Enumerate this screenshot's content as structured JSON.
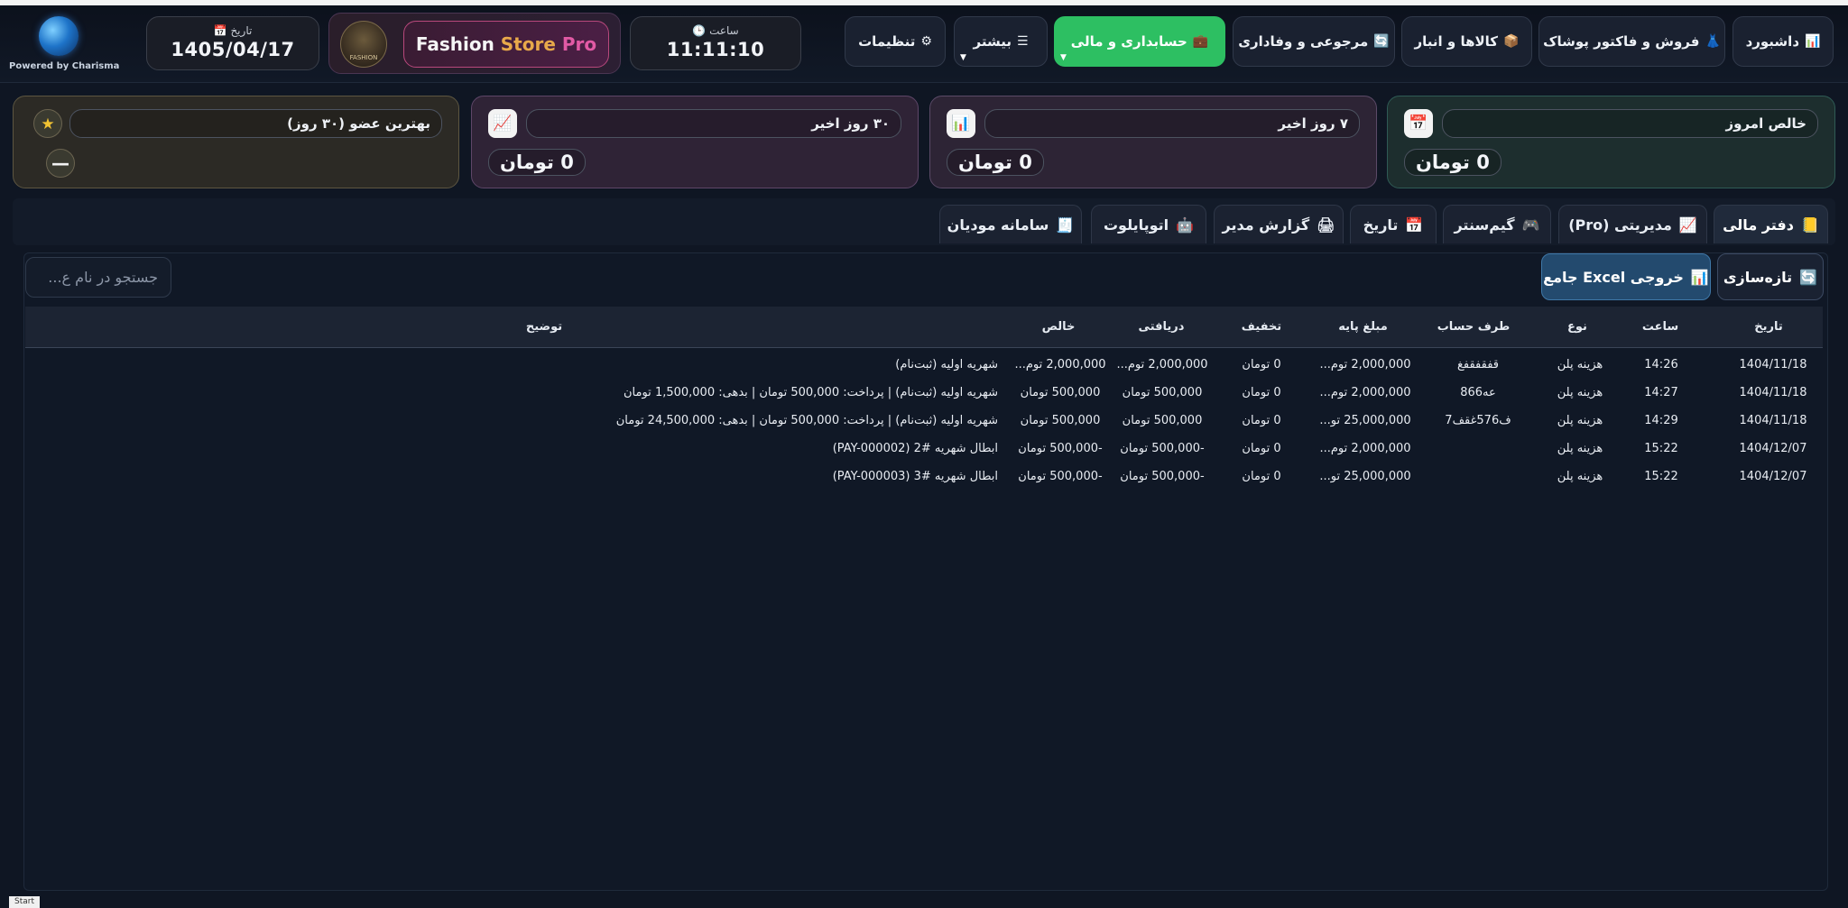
{
  "header": {
    "logo_text": "Powered by Charisma",
    "date_label": "تاریخ",
    "date_icon": "calendar-icon",
    "date_value": "1405/04/17",
    "time_label": "ساعت",
    "time_icon": "clock-icon",
    "time_value": "11:11:10",
    "brand_logo_text": "FASHION",
    "brand_word1": "Fashion",
    "brand_word2": "Store",
    "brand_word3": "Pro",
    "nav": [
      {
        "label": "داشبورد",
        "icon": "chart-icon"
      },
      {
        "label": "فروش و فاکتور پوشاک",
        "icon": "dress-icon"
      },
      {
        "label": "کالاها و انبار",
        "icon": "box-icon"
      },
      {
        "label": "مرجوعی و وفاداری",
        "icon": "refresh-icon"
      },
      {
        "label": "حسابداری و مالی",
        "icon": "briefcase-icon"
      },
      {
        "label": "بیشتر",
        "icon": "menu-icon"
      },
      {
        "label": "تنظیمات",
        "icon": "gear-icon"
      }
    ]
  },
  "cards": [
    {
      "label": "بهترین عضو (۳۰ روز)",
      "icon": "star-icon",
      "value": "—"
    },
    {
      "label": "۳۰ روز اخیر",
      "icon": "trend-up-icon",
      "value": "0 تومان"
    },
    {
      "label": "۷ روز اخیر",
      "icon": "bar-chart-icon",
      "value": "0 تومان"
    },
    {
      "label": "خالص امروز",
      "icon": "calendar-icon",
      "value": "0 تومان"
    }
  ],
  "tabs": [
    {
      "label": "دفتر مالی",
      "icon": "ledger-icon"
    },
    {
      "label": "مدیریتی (Pro)",
      "icon": "trend-up-icon"
    },
    {
      "label": "گیم‌سنتر",
      "icon": "gamepad-icon"
    },
    {
      "label": "تاریخ",
      "icon": "calendar-icon"
    },
    {
      "label": "گزارش مدیر",
      "icon": "printer-icon"
    },
    {
      "label": "اتوپایلوت",
      "icon": "robot-icon"
    },
    {
      "label": "سامانه مودیان",
      "icon": "receipt-icon"
    }
  ],
  "toolbar": {
    "refresh_label": "تازه‌سازی",
    "excel_label": "خروجی Excel جامع",
    "search_placeholder": "جستجو در نام ع..."
  },
  "table": {
    "columns": [
      "تاریخ",
      "ساعت",
      "نوع",
      "طرف حساب",
      "مبلغ پایه",
      "تخفیف",
      "دریافتی",
      "خالص",
      "توضیح"
    ],
    "rows": [
      [
        "1404/11/18",
        "14:26",
        "هزینه پلن",
        "قفقفقفغ",
        "2,000,000 توم...",
        "0 تومان",
        "2,000,000 توم...",
        "2,000,000 توم...",
        "شهریه اولیه (ثبت‌نام)"
      ],
      [
        "1404/11/18",
        "14:27",
        "هزینه پلن",
        "عه866",
        "2,000,000 توم...",
        "0 تومان",
        "500,000 تومان",
        "500,000 تومان",
        "شهریه اولیه (ثبت‌نام) | پرداخت: 500,000 تومان | بدهی: 1,500,000 تومان"
      ],
      [
        "1404/11/18",
        "14:29",
        "هزینه پلن",
        "ف576غقف7",
        "25,000,000 تو...",
        "0 تومان",
        "500,000 تومان",
        "500,000 تومان",
        "شهریه اولیه (ثبت‌نام) | پرداخت: 500,000 تومان | بدهی: 24,500,000 تومان"
      ],
      [
        "1404/12/07",
        "15:22",
        "هزینه پلن",
        "",
        "2,000,000 توم...",
        "0 تومان",
        "-500,000 تومان",
        "-500,000 تومان",
        "ابطال شهریه #2 (PAY-000002)"
      ],
      [
        "1404/12/07",
        "15:22",
        "هزینه پلن",
        "",
        "25,000,000 تو...",
        "0 تومان",
        "-500,000 تومان",
        "-500,000 تومان",
        "ابطال شهریه #3 (PAY-000003)"
      ]
    ]
  },
  "footer": {
    "start_label": "Start"
  }
}
